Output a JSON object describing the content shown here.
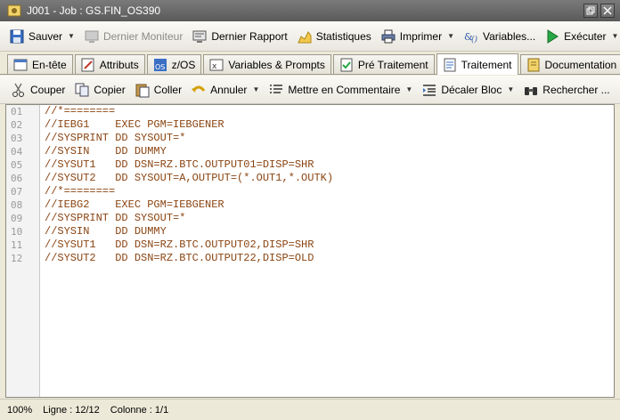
{
  "window": {
    "title": "J001 - Job : GS.FIN_OS390"
  },
  "toolbar": {
    "items": [
      {
        "label": "Sauver",
        "icon": "save-icon"
      },
      {
        "label": "Dernier Moniteur",
        "icon": "monitor-icon",
        "disabled": true
      },
      {
        "label": "Dernier Rapport",
        "icon": "report-icon"
      },
      {
        "label": "Statistiques",
        "icon": "statistics-icon"
      },
      {
        "label": "Imprimer",
        "icon": "printer-icon"
      },
      {
        "label": "Variables...",
        "icon": "variables-icon"
      },
      {
        "label": "Exécuter",
        "icon": "play-icon"
      }
    ]
  },
  "tabs": [
    {
      "label": "En-tête",
      "icon": "header-icon"
    },
    {
      "label": "Attributs",
      "icon": "attributes-icon"
    },
    {
      "label": "z/OS",
      "icon": "os-icon"
    },
    {
      "label": "Variables & Prompts",
      "icon": "variables-prompts-icon"
    },
    {
      "label": "Pré Traitement",
      "icon": "pre-process-icon"
    },
    {
      "label": "Traitement",
      "icon": "process-icon",
      "active": true
    },
    {
      "label": "Documentation",
      "icon": "documentation-icon"
    }
  ],
  "edit_toolbar": {
    "items": [
      {
        "label": "Couper",
        "icon": "scissors-icon"
      },
      {
        "label": "Copier",
        "icon": "copy-icon"
      },
      {
        "label": "Coller",
        "icon": "paste-icon"
      },
      {
        "label": "Annuler",
        "icon": "undo-icon"
      },
      {
        "label": "Mettre en Commentaire",
        "icon": "comment-icon"
      },
      {
        "label": "Décaler Bloc",
        "icon": "indent-icon"
      },
      {
        "label": "Rechercher ...",
        "icon": "binoculars-icon"
      }
    ]
  },
  "editor": {
    "line_numbers": [
      "01",
      "02",
      "03",
      "04",
      "05",
      "06",
      "07",
      "08",
      "09",
      "10",
      "11",
      "12"
    ],
    "lines": [
      "//*========",
      "//IEBG1    EXEC PGM=IEBGENER",
      "//SYSPRINT DD SYSOUT=*",
      "//SYSIN    DD DUMMY",
      "//SYSUT1   DD DSN=RZ.BTC.OUTPUT01=DISP=SHR",
      "//SYSUT2   DD SYSOUT=A,OUTPUT=(*.OUT1,*.OUTK)",
      "//*========",
      "//IEBG2    EXEC PGM=IEBGENER",
      "//SYSPRINT DD SYSOUT=*",
      "//SYSIN    DD DUMMY",
      "//SYSUT1   DD DSN=RZ.BTC.OUTPUT02,DISP=SHR",
      "//SYSUT2   DD DSN=RZ.BTC.OUTPUT22,DISP=OLD"
    ]
  },
  "status": {
    "zoom": "100%",
    "line": "Ligne : 12/12",
    "column": "Colonne : 1/1"
  },
  "colors": {
    "code_text": "#8b4513",
    "title_bar": "#6a6a6a"
  }
}
